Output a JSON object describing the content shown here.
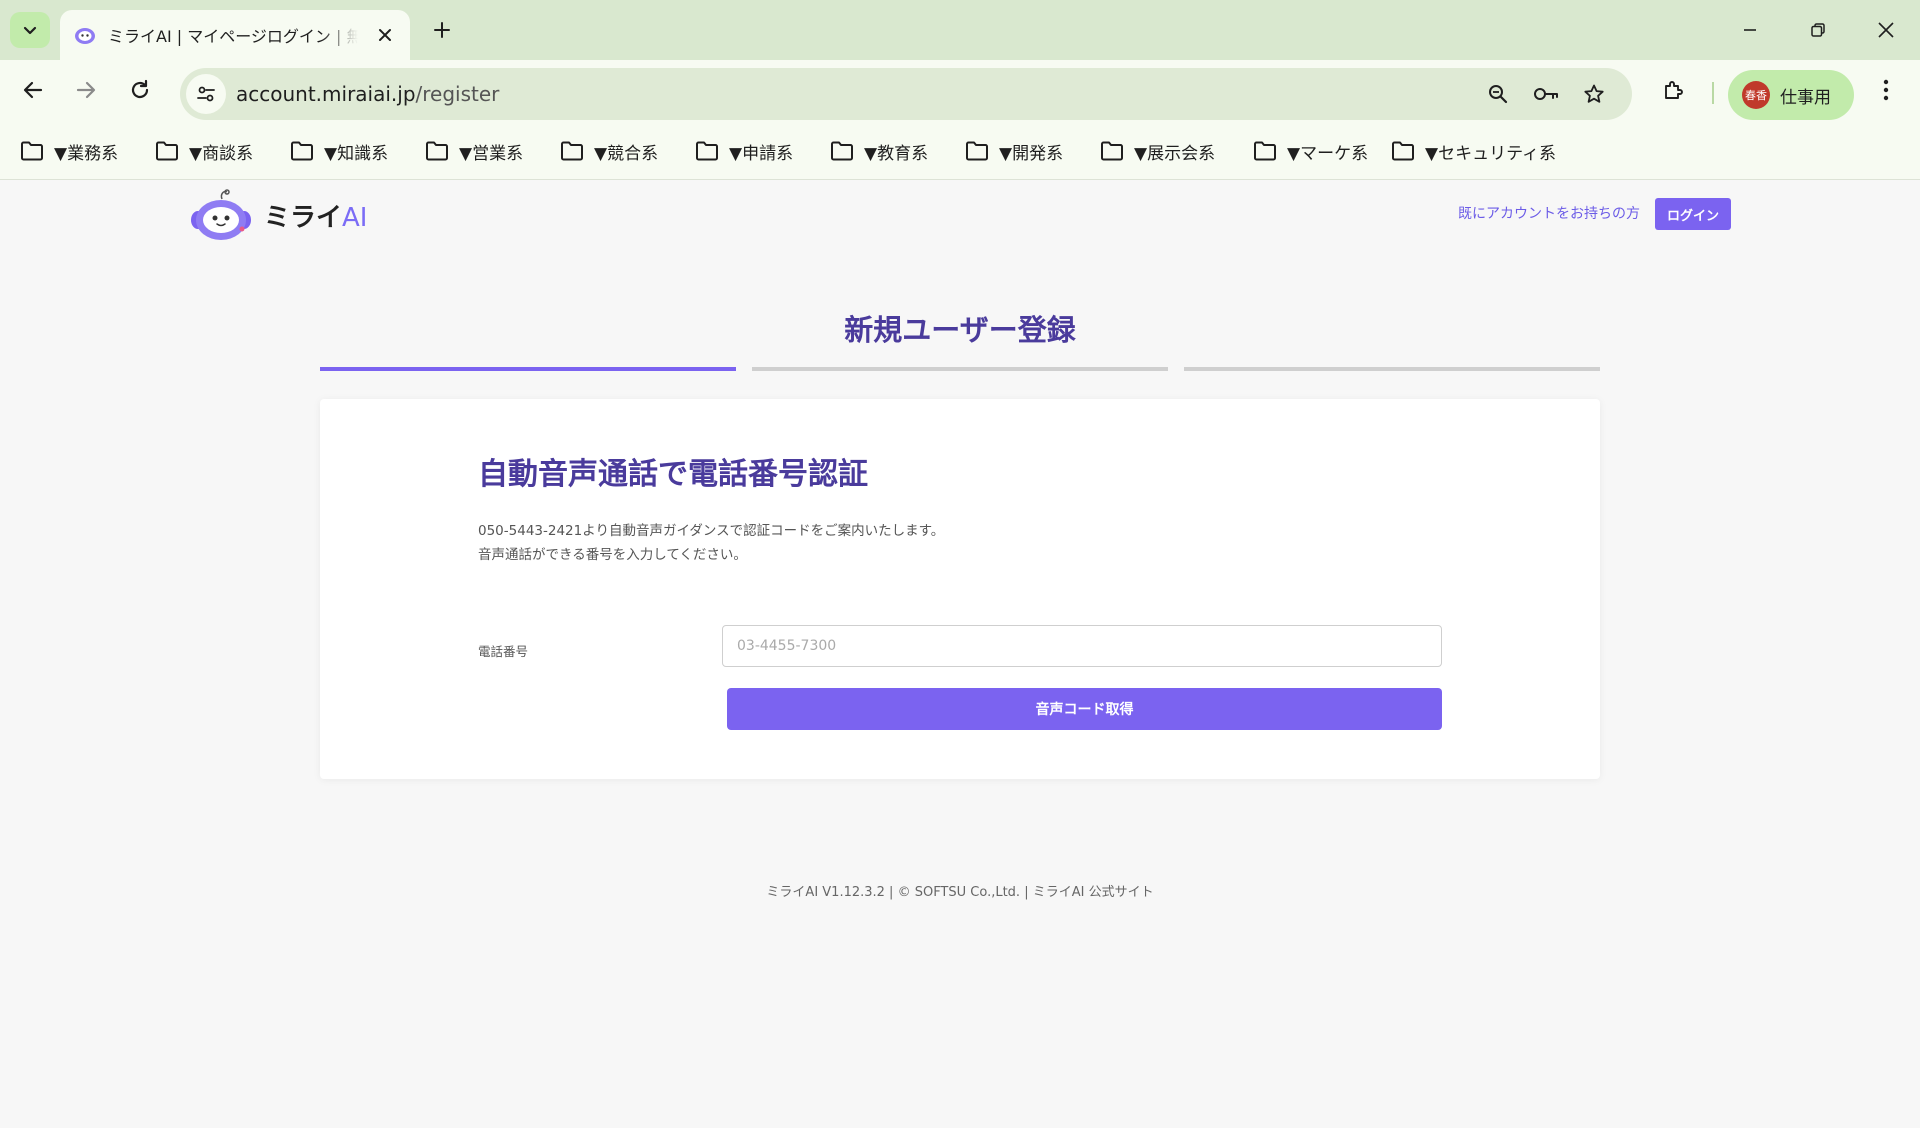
{
  "browser": {
    "tab_title": "ミライAI | マイページログイン | 無料で始める",
    "url_host": "account.miraiai.jp",
    "url_path": "/register",
    "profile_avatar_text": "春香",
    "profile_name": "仕事用"
  },
  "bookmarks": [
    {
      "label": "▼業務系"
    },
    {
      "label": "▼商談系"
    },
    {
      "label": "▼知識系"
    },
    {
      "label": "▼営業系"
    },
    {
      "label": "▼競合系"
    },
    {
      "label": "▼申請系"
    },
    {
      "label": "▼教育系"
    },
    {
      "label": "▼開発系"
    },
    {
      "label": "▼展示会系"
    },
    {
      "label": "▼マーケ系"
    },
    {
      "label": "▼セキュリティ系"
    }
  ],
  "header": {
    "logo_text": "ミライ",
    "logo_ai": "AI",
    "have_account": "既にアカウントをお持ちの方",
    "login_label": "ログイン"
  },
  "registration": {
    "title": "新規ユーザー登録",
    "steps_total": 3,
    "current_step": 1
  },
  "form": {
    "heading": "自動音声通話で電話番号認証",
    "desc_line1": "050-5443-2421より自動音声ガイダンスで認証コードをご案内いたします。",
    "desc_line2": "音声通話ができる番号を入力してください。",
    "phone_label": "電話番号",
    "phone_placeholder": "03-4455-7300",
    "phone_value": "",
    "submit_label": "音声コード取得"
  },
  "footer": {
    "text": "ミライAI V1.12.3.2 | © SOFTSU Co.,Ltd. | ミライAI 公式サイト"
  },
  "colors": {
    "accent": "#7b63f0",
    "heading": "#4a3b9c",
    "chrome_green": "#d9e8cf"
  }
}
